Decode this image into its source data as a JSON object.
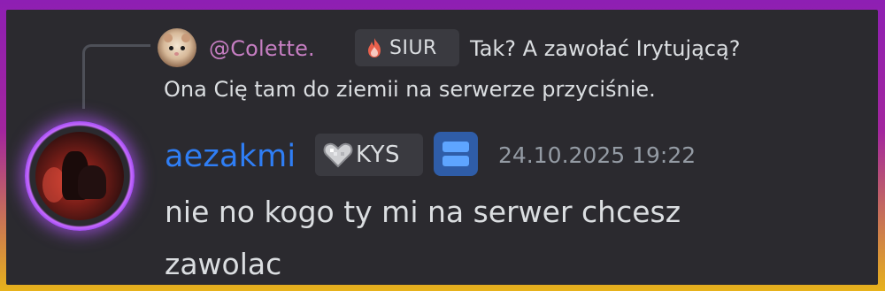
{
  "reply": {
    "author": "@Colette.",
    "badge": "SIUR",
    "text_line1": "Tak? A zawołać Irytującą?",
    "text_line2": "Ona Cię tam do ziemii na serwerze przyciśnie."
  },
  "message": {
    "author": "aezakmi",
    "badge": "KYS",
    "timestamp": "24.10.2025 19:22",
    "content_line1": "nie no kogo ty mi na serwer chcesz",
    "content_line2": "zawolac"
  },
  "colors": {
    "reply_author": "#c67ec2",
    "author": "#2f7ef5",
    "avatar_ring": "#a24df2",
    "background": "#2b2a2f"
  },
  "icons": {
    "reply_badge": "flame-icon",
    "author_badge": "heart-icon",
    "server_tag": "server-icon"
  }
}
